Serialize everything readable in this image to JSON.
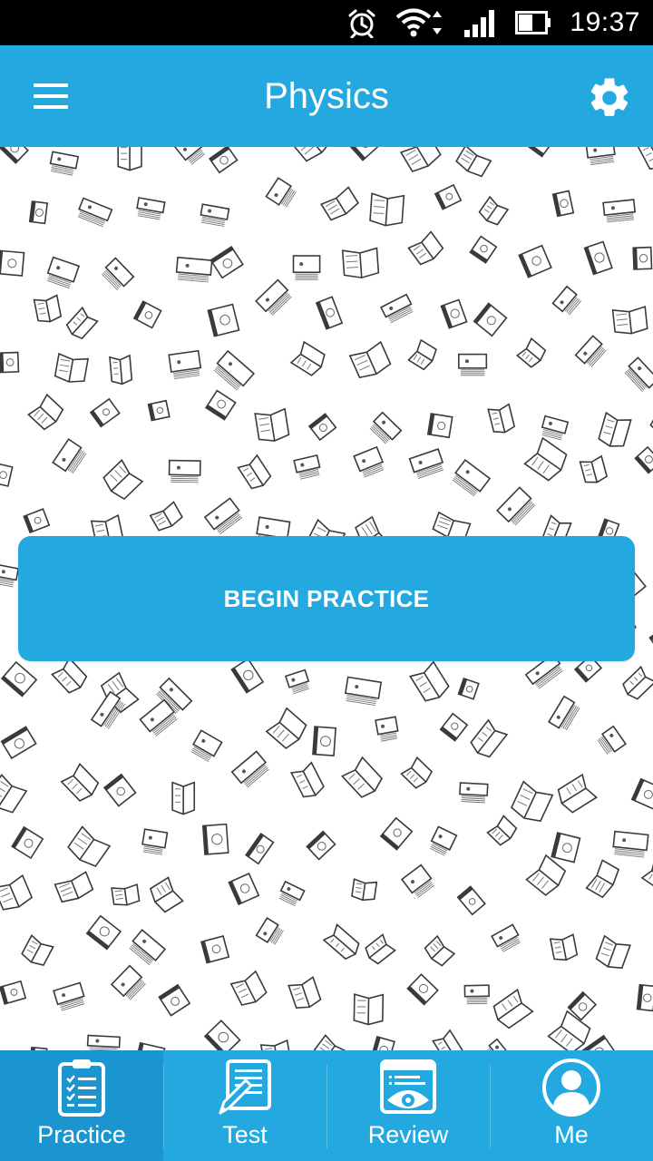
{
  "status_bar": {
    "time": "19:37",
    "icons": [
      "alarm-icon",
      "wifi-icon",
      "cellular-signal-icon",
      "battery-icon"
    ]
  },
  "app_bar": {
    "title": "Physics",
    "menu_icon": "hamburger-menu-icon",
    "settings_icon": "gear-icon"
  },
  "main": {
    "begin_button_label": "BEGIN PRACTICE",
    "background_pattern": "sketched-books-pattern"
  },
  "bottom_nav": {
    "items": [
      {
        "label": "Practice",
        "icon": "checklist-icon",
        "active": true
      },
      {
        "label": "Test",
        "icon": "test-pencil-icon",
        "active": false
      },
      {
        "label": "Review",
        "icon": "review-eye-icon",
        "active": false
      },
      {
        "label": "Me",
        "icon": "profile-icon",
        "active": false
      }
    ]
  },
  "colors": {
    "accent": "#24a8e0",
    "accent_active": "#1a95cf",
    "status_bar": "#000000",
    "text_on_accent": "#ffffff"
  }
}
